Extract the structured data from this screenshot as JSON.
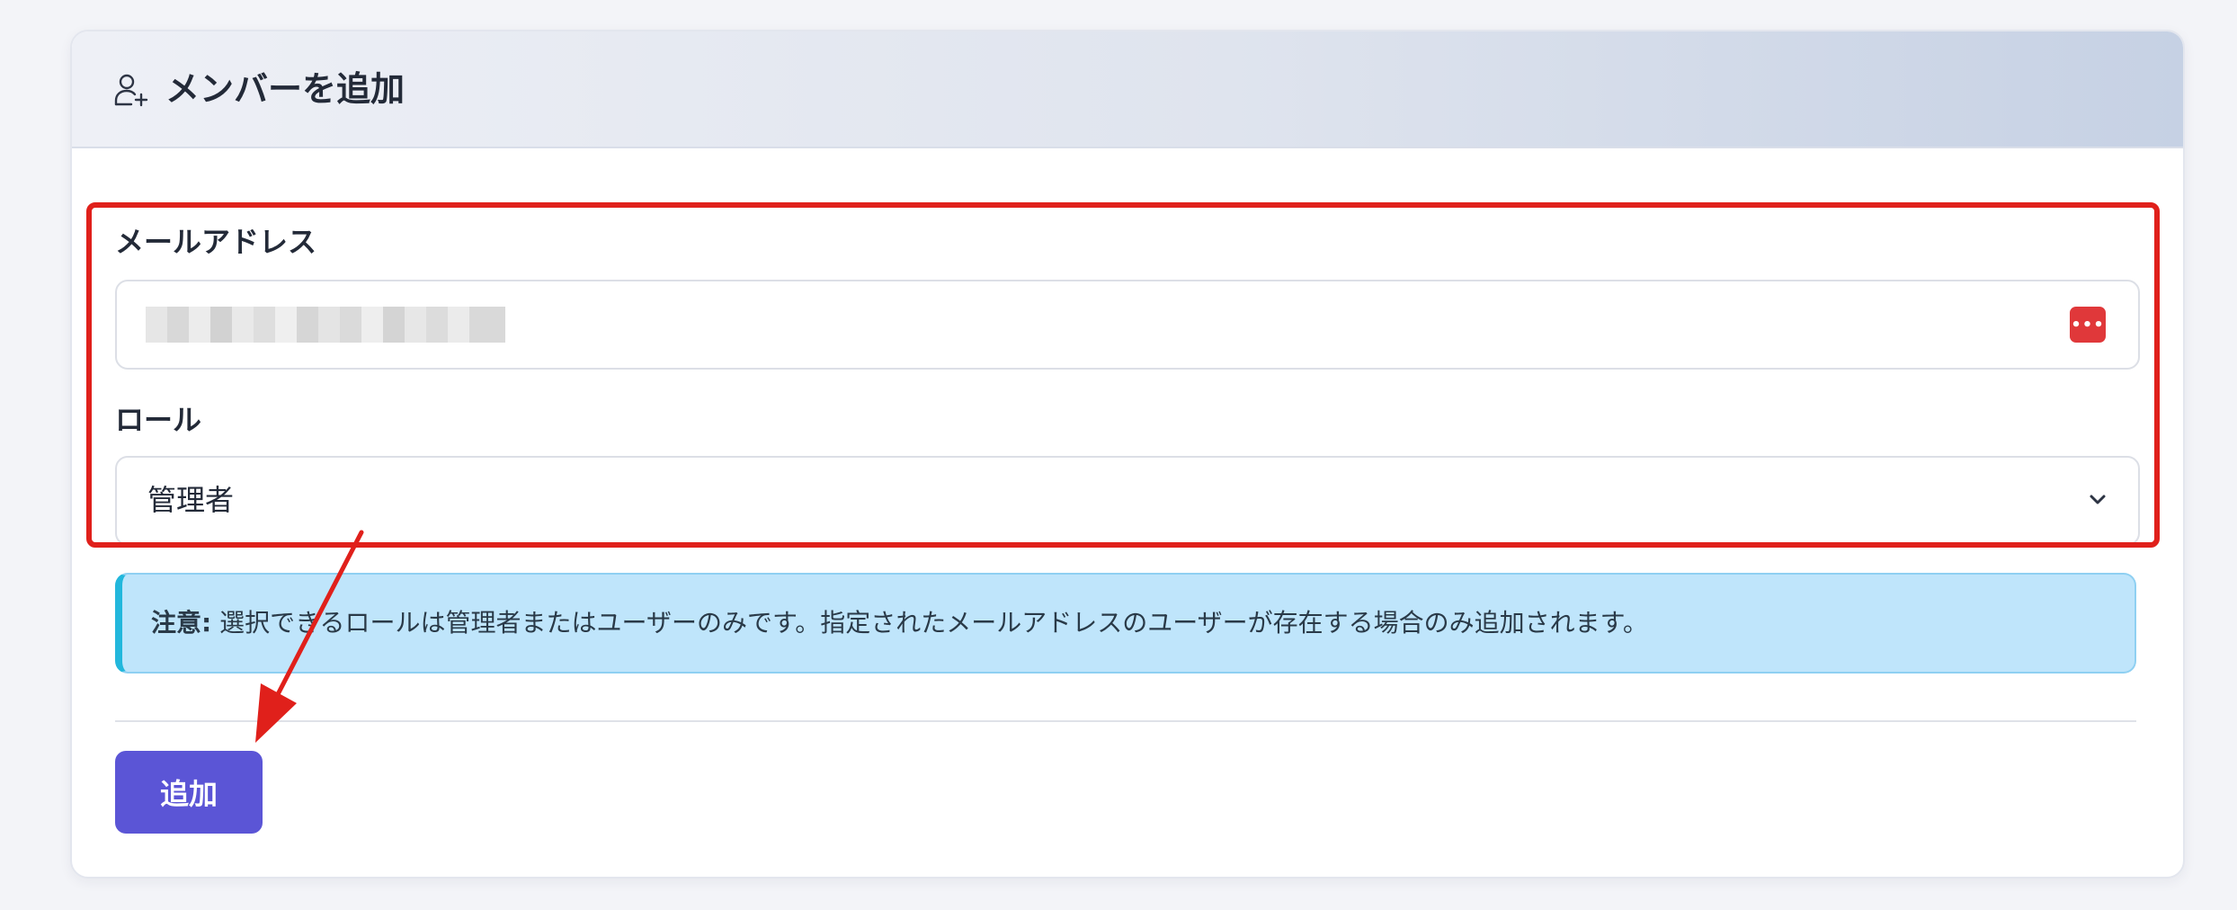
{
  "panel": {
    "title": "メンバーを追加",
    "icon": "user-plus-icon"
  },
  "form": {
    "email": {
      "label": "メールアドレス",
      "value": "",
      "value_note": "pixelated / redacted"
    },
    "role": {
      "label": "ロール",
      "selected": "管理者"
    }
  },
  "notice": {
    "strong": "注意:",
    "text": "選択できるロールは管理者またはユーザーのみです。指定されたメールアドレスのユーザーが存在する場合のみ追加されます。"
  },
  "actions": {
    "add_label": "追加"
  },
  "colors": {
    "primary": "#5b55d6",
    "highlight": "#e0201b",
    "notice_bg": "#bfe5fb",
    "notice_accent": "#22b7dc",
    "password_manager": "#e0383a"
  }
}
